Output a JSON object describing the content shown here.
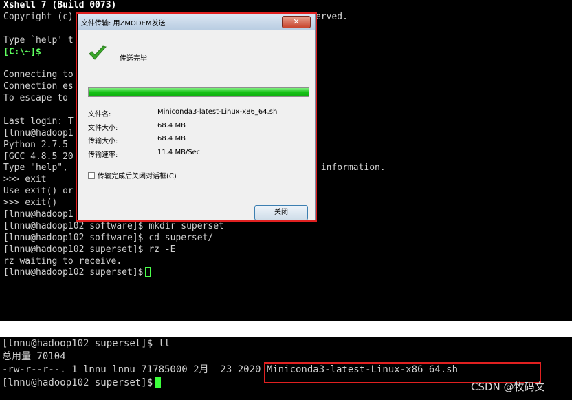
{
  "terminal_top": {
    "lines": [
      {
        "text": "Xshell 7 (Build 0073)",
        "style": "bold"
      },
      {
        "text": "Copyright (c)                                          reserved.",
        "style": ""
      },
      {
        "text": "",
        "style": ""
      },
      {
        "text": "Type `help' t",
        "style": ""
      },
      {
        "text": "[C:\\~]$",
        "style": "green"
      },
      {
        "text": "",
        "style": ""
      },
      {
        "text": "Connecting to",
        "style": ""
      },
      {
        "text": "Connection es",
        "style": ""
      },
      {
        "text": "To escape to",
        "style": ""
      },
      {
        "text": "",
        "style": ""
      },
      {
        "text": "Last login: T                                          2",
        "style": ""
      },
      {
        "text": "[lnnu@hadoop1",
        "style": ""
      },
      {
        "text": "Python 2.7.5",
        "style": ""
      },
      {
        "text": "[GCC 4.8.5 20",
        "style": ""
      },
      {
        "text": "Type \"help\",                                           ore information.",
        "style": ""
      },
      {
        "text": ">>> exit",
        "style": ""
      },
      {
        "text": "Use exit() or",
        "style": ""
      },
      {
        "text": ">>> exit()",
        "style": ""
      },
      {
        "text": "[lnnu@hadoop1",
        "style": ""
      },
      {
        "text": "[lnnu@hadoop102 software]$ mkdir superset",
        "style": ""
      },
      {
        "text": "[lnnu@hadoop102 software]$ cd superset/",
        "style": ""
      },
      {
        "text": "[lnnu@hadoop102 superset]$ rz -E",
        "style": ""
      },
      {
        "text": "rz waiting to receive.",
        "style": ""
      },
      {
        "text": "[lnnu@hadoop102 superset]$",
        "style": "",
        "cursor": "outline"
      }
    ]
  },
  "terminal_bottom": {
    "lines": [
      {
        "text": "[lnnu@hadoop102 superset]$ ll"
      },
      {
        "text": "总用量 70104"
      },
      {
        "text": "-rw-r--r--. 1 lnnu lnnu 71785000 2月  23 2020 Miniconda3-latest-Linux-x86_64.sh"
      },
      {
        "text": "[lnnu@hadoop102 superset]$",
        "cursor": "solid"
      }
    ]
  },
  "dialog": {
    "title": "文件传输: 用ZMODEM发送",
    "close_icon": "x-icon",
    "close_glyph": "✕",
    "status": "传送完毕",
    "progress": 1.0,
    "rows": [
      {
        "label": "文件名:",
        "value": "Miniconda3-latest-Linux-x86_64.sh"
      },
      {
        "label": "文件大小:",
        "value": "68.4 MB"
      },
      {
        "label": "传输大小:",
        "value": "68.4 MB"
      },
      {
        "label": "传输速率:",
        "value": "11.4 MB/Sec"
      }
    ],
    "checkbox_label": "传输完成后关闭对话框(C)",
    "close_button": "关闭",
    "colors": {
      "progress": "#17c217",
      "check": "#3aa82a"
    }
  },
  "highlight_color": "#e02020",
  "watermark": "CSDN @牧码文"
}
